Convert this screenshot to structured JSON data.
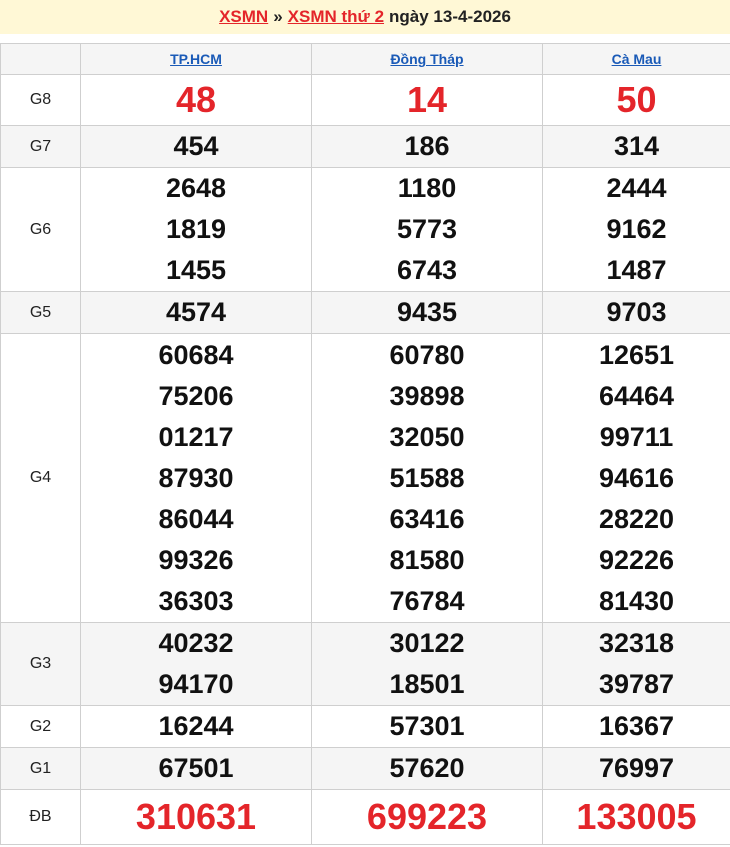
{
  "header": {
    "link1": "XSMN",
    "sep": "»",
    "link2": "XSMN thứ 2",
    "date_text": "ngày 13-4-2026"
  },
  "provinces": [
    "TP.HCM",
    "Đồng Tháp",
    "Cà Mau"
  ],
  "rows": [
    {
      "label": "G8",
      "values": [
        [
          "48"
        ],
        [
          "14"
        ],
        [
          "50"
        ]
      ]
    },
    {
      "label": "G7",
      "values": [
        [
          "454"
        ],
        [
          "186"
        ],
        [
          "314"
        ]
      ]
    },
    {
      "label": "G6",
      "values": [
        [
          "2648",
          "1819",
          "1455"
        ],
        [
          "1180",
          "5773",
          "6743"
        ],
        [
          "2444",
          "9162",
          "1487"
        ]
      ]
    },
    {
      "label": "G5",
      "values": [
        [
          "4574"
        ],
        [
          "9435"
        ],
        [
          "9703"
        ]
      ]
    },
    {
      "label": "G4",
      "values": [
        [
          "60684",
          "75206",
          "01217",
          "87930",
          "86044",
          "99326",
          "36303"
        ],
        [
          "60780",
          "39898",
          "32050",
          "51588",
          "63416",
          "81580",
          "76784"
        ],
        [
          "12651",
          "64464",
          "99711",
          "94616",
          "28220",
          "92226",
          "81430"
        ]
      ]
    },
    {
      "label": "G3",
      "values": [
        [
          "40232",
          "94170"
        ],
        [
          "30122",
          "18501"
        ],
        [
          "32318",
          "39787"
        ]
      ]
    },
    {
      "label": "G2",
      "values": [
        [
          "16244"
        ],
        [
          "57301"
        ],
        [
          "16367"
        ]
      ]
    },
    {
      "label": "G1",
      "values": [
        [
          "67501"
        ],
        [
          "57620"
        ],
        [
          "76997"
        ]
      ]
    },
    {
      "label": "ĐB",
      "values": [
        [
          "310631"
        ],
        [
          "699223"
        ],
        [
          "133005"
        ]
      ]
    }
  ],
  "colors": {
    "accent_red": "#e4252a",
    "link_blue": "#1a5ab7",
    "header_bg": "#fff8d6"
  }
}
